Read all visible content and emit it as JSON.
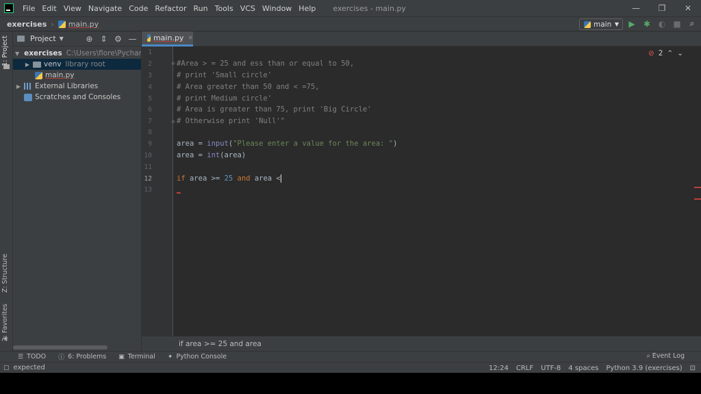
{
  "titlebar": {
    "menu": [
      "File",
      "Edit",
      "View",
      "Navigate",
      "Code",
      "Refactor",
      "Run",
      "Tools",
      "VCS",
      "Window",
      "Help"
    ],
    "window_title": "exercises - main.py",
    "controls": {
      "minimize": "—",
      "restore": "❐",
      "close": "✕"
    }
  },
  "navbar": {
    "project": "exercises",
    "file": "main.py",
    "run_config": "main"
  },
  "left_strip": {
    "project_tab": "1: Project",
    "structure_tab": "Z: Structure",
    "favorites_tab": "2: Favorites"
  },
  "project_panel": {
    "title": "Project",
    "tree": {
      "root_name": "exercises",
      "root_path": "C:\\Users\\flore\\PycharmPr",
      "venv": "venv",
      "venv_note": "library root",
      "main": "main.py",
      "external": "External Libraries",
      "scratches": "Scratches and Consoles"
    }
  },
  "editor": {
    "tab_label": "main.py",
    "line_numbers": [
      "1",
      "2",
      "3",
      "4",
      "5",
      "6",
      "7",
      "8",
      "9",
      "10",
      "11",
      "12",
      "13"
    ],
    "current_line": "12",
    "error_count": "2",
    "lines": {
      "l2": "#Area > = 25 and ess than or equal to 50,",
      "l3": "# print 'Small circle'",
      "l4": "# Area greater than 50 and < =75,",
      "l5": "# print Medium circle'",
      "l6": "# Area is greater than 75, print 'Big Circle'",
      "l7": "# Otherwise print 'Null'\"",
      "l9": {
        "var": "area",
        "op": " = ",
        "fn": "input",
        "open": "(",
        "str": "\"Please enter a value for the area: \"",
        "close": ")"
      },
      "l10": {
        "var": "area",
        "op": " = ",
        "fn": "int",
        "args": "(area)"
      },
      "l12": {
        "kw1": "if",
        "mid1": " area >= ",
        "num": "25",
        "sp": " ",
        "kw2": "and",
        "mid2": " area <"
      }
    },
    "breadcrumb_hint": "if area >= 25 and area"
  },
  "tool_windows": {
    "todo": "TODO",
    "problems": "6: Problems",
    "terminal": "Terminal",
    "python_console": "Python Console",
    "event_log": "Event Log"
  },
  "status": {
    "message": "expected",
    "position": "12:24",
    "line_sep": "CRLF",
    "encoding": "UTF-8",
    "indent": "4 spaces",
    "interpreter": "Python 3.9 (exercises)"
  }
}
